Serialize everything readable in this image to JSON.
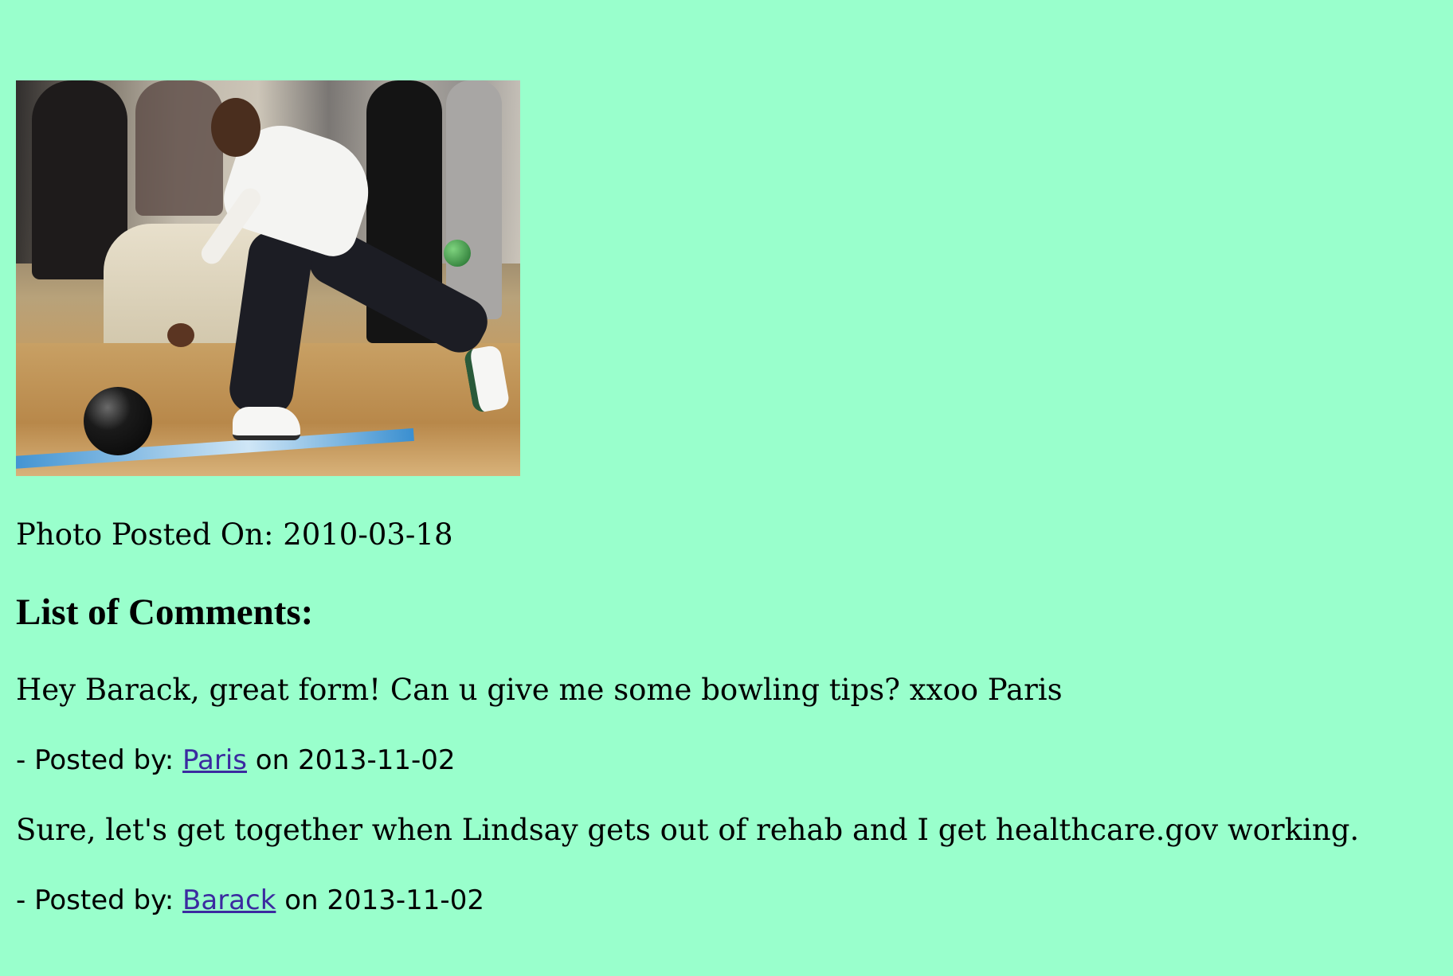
{
  "photo": {
    "posted_on_label": "Photo Posted On:",
    "posted_on_date": "2010-03-18"
  },
  "comments_heading": "List of Comments:",
  "comments": [
    {
      "text": "Hey Barack, great form! Can u give me some bowling tips? xxoo Paris",
      "posted_by_label": "- Posted by:",
      "author": "Paris",
      "on_label": "on",
      "date": "2013-11-02"
    },
    {
      "text": "Sure, let's get together when Lindsay gets out of rehab and I get healthcare.gov working.",
      "posted_by_label": "- Posted by:",
      "author": "Barack",
      "on_label": "on",
      "date": "2013-11-02"
    }
  ],
  "colors": {
    "background": "#99ffcc",
    "link": "#3b2aa0"
  }
}
